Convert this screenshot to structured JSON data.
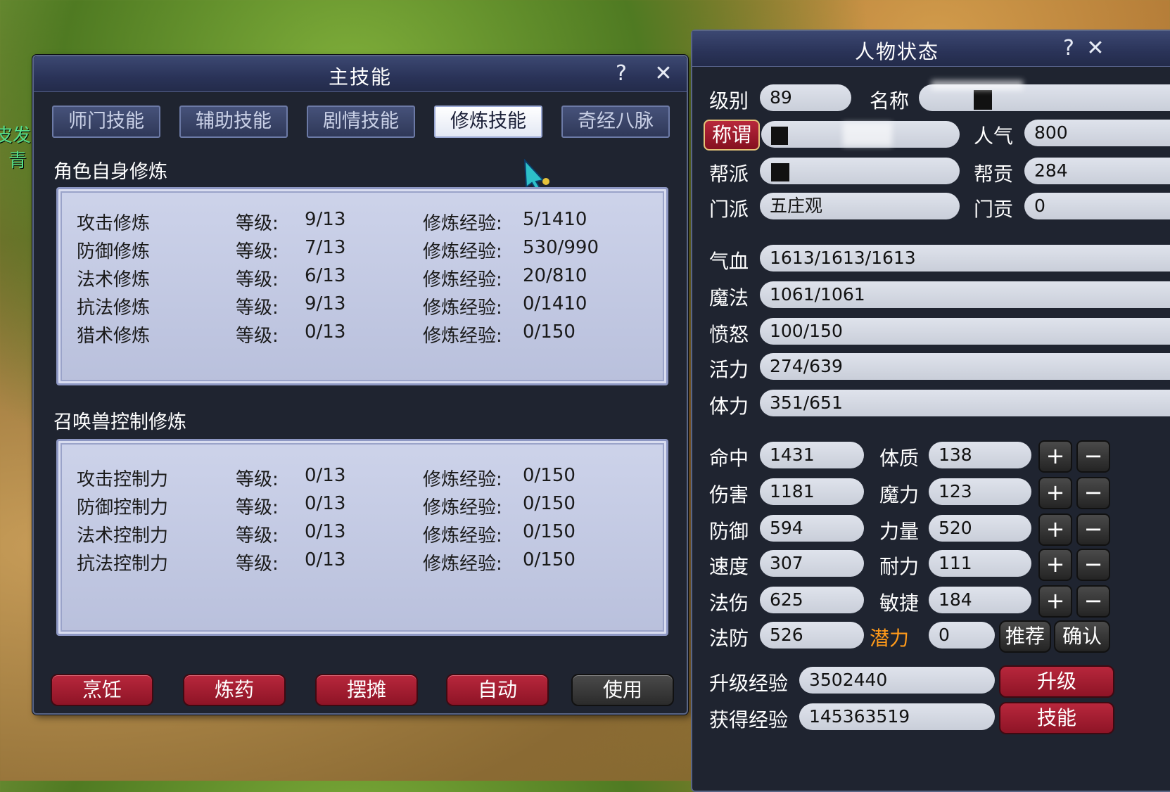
{
  "scenery": {
    "left_texts": [
      "皮发",
      "青"
    ]
  },
  "skill_window": {
    "title": "主技能",
    "help": "?",
    "close": "✕",
    "tabs": [
      "师门技能",
      "辅助技能",
      "剧情技能",
      "修炼技能",
      "奇经八脉"
    ],
    "active_tab": "修炼技能",
    "self_section": {
      "title": "角色自身修炼",
      "rows": [
        {
          "name": "攻击修炼",
          "level_label": "等级:",
          "level": "9/13",
          "exp_label": "修炼经验:",
          "exp": "5/1410"
        },
        {
          "name": "防御修炼",
          "level_label": "等级:",
          "level": "7/13",
          "exp_label": "修炼经验:",
          "exp": "530/990"
        },
        {
          "name": "法术修炼",
          "level_label": "等级:",
          "level": "6/13",
          "exp_label": "修炼经验:",
          "exp": "20/810"
        },
        {
          "name": "抗法修炼",
          "level_label": "等级:",
          "level": "9/13",
          "exp_label": "修炼经验:",
          "exp": "0/1410"
        },
        {
          "name": "猎术修炼",
          "level_label": "等级:",
          "level": "0/13",
          "exp_label": "修炼经验:",
          "exp": "0/150"
        }
      ]
    },
    "pet_section": {
      "title": "召唤兽控制修炼",
      "rows": [
        {
          "name": "攻击控制力",
          "level_label": "等级:",
          "level": "0/13",
          "exp_label": "修炼经验:",
          "exp": "0/150"
        },
        {
          "name": "防御控制力",
          "level_label": "等级:",
          "level": "0/13",
          "exp_label": "修炼经验:",
          "exp": "0/150"
        },
        {
          "name": "法术控制力",
          "level_label": "等级:",
          "level": "0/13",
          "exp_label": "修炼经验:",
          "exp": "0/150"
        },
        {
          "name": "抗法控制力",
          "level_label": "等级:",
          "level": "0/13",
          "exp_label": "修炼经验:",
          "exp": "0/150"
        }
      ]
    },
    "buttons": [
      "烹饪",
      "炼药",
      "摆摊",
      "自动",
      "使用"
    ]
  },
  "status_window": {
    "title": "人物状态",
    "help": "?",
    "close": "✕",
    "level_label": "级别",
    "level": "89",
    "name_label": "名称",
    "name": "",
    "title_label": "称谓",
    "title_value": "",
    "popularity_label": "人气",
    "popularity": "800",
    "guild_label": "帮派",
    "guild": "",
    "guild_contrib_label": "帮贡",
    "guild_contrib": "284",
    "sect_label": "门派",
    "sect": "五庄观",
    "sect_contrib_label": "门贡",
    "sect_contrib": "0",
    "bars": [
      {
        "label": "气血",
        "value": "1613/1613/1613"
      },
      {
        "label": "魔法",
        "value": "1061/1061"
      },
      {
        "label": "愤怒",
        "value": "100/150"
      },
      {
        "label": "活力",
        "value": "274/639"
      },
      {
        "label": "体力",
        "value": "351/651"
      }
    ],
    "stats": [
      {
        "label": "命中",
        "value": "1431",
        "attr_label": "体质",
        "attr": "138"
      },
      {
        "label": "伤害",
        "value": "1181",
        "attr_label": "魔力",
        "attr": "123"
      },
      {
        "label": "防御",
        "value": "594",
        "attr_label": "力量",
        "attr": "520"
      },
      {
        "label": "速度",
        "value": "307",
        "attr_label": "耐力",
        "attr": "111"
      },
      {
        "label": "法伤",
        "value": "625",
        "attr_label": "敏捷",
        "attr": "184"
      }
    ],
    "plus": "+",
    "minus": "−",
    "magic_def_label": "法防",
    "magic_def": "526",
    "potential_label": "潜力",
    "potential": "0",
    "recommend_button": "推荐",
    "confirm_button": "确认",
    "upgrade_exp_label": "升级经验",
    "upgrade_exp": "3502440",
    "upgrade_button": "升级",
    "gained_exp_label": "获得经验",
    "gained_exp": "145363519",
    "skills_button": "技能",
    "colors": {
      "potential": "#ff9a1a",
      "red_button": "#a51d32"
    }
  }
}
